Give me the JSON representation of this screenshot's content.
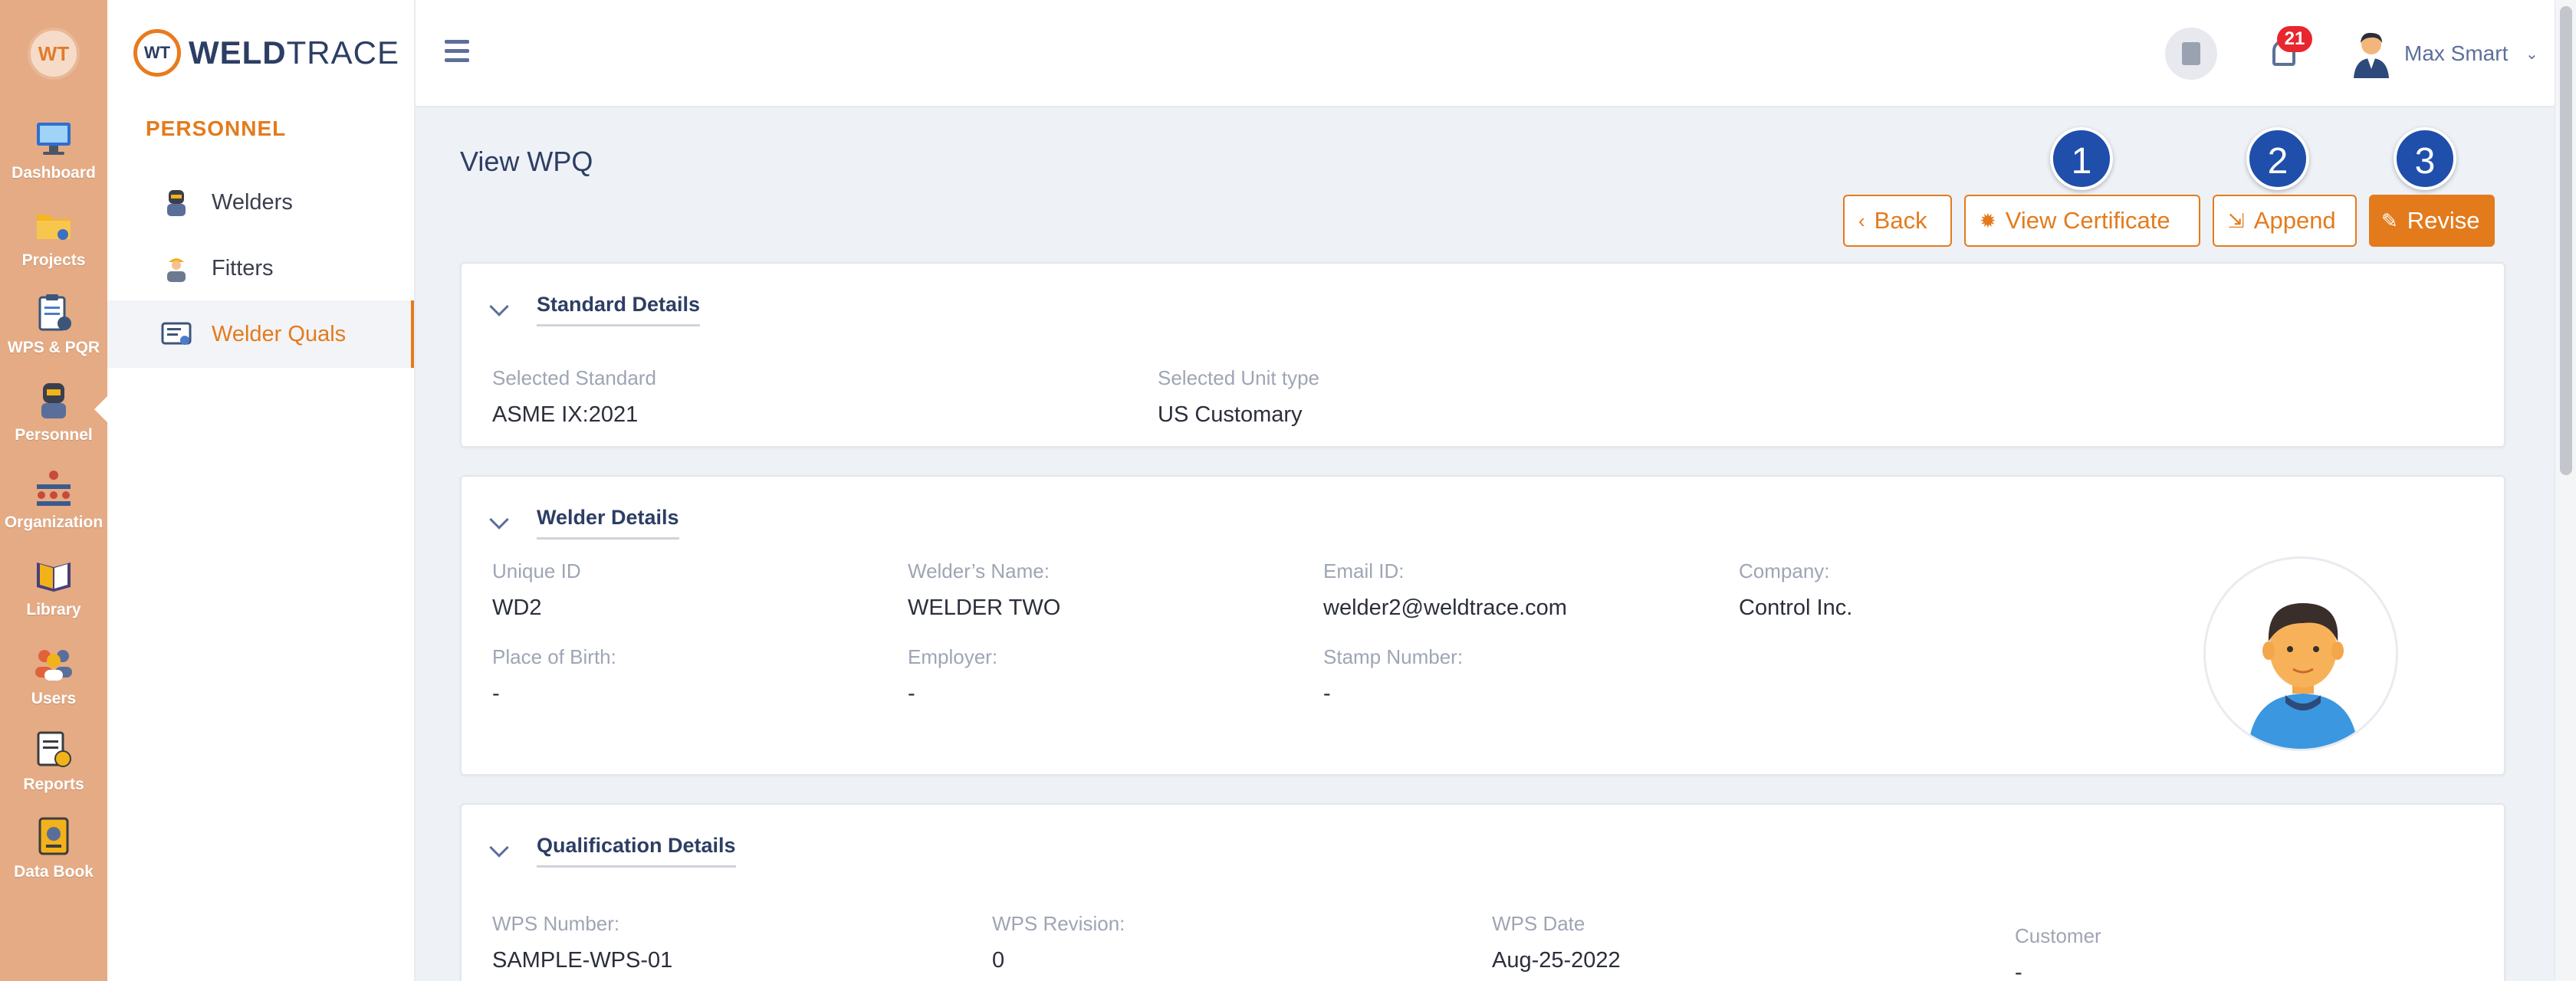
{
  "app": {
    "logo_text": "WT",
    "brand_bold": "WELD",
    "brand_light": "TRACE"
  },
  "rail": {
    "items": [
      {
        "label": "Dashboard",
        "icon": "monitor-icon",
        "color": "#3b76d1"
      },
      {
        "label": "Projects",
        "icon": "folder-icon",
        "color": "#f2b21a"
      },
      {
        "label": "WPS & PQR",
        "icon": "clipboard-icon",
        "color": "#4a7cc9"
      },
      {
        "label": "Personnel",
        "icon": "welder-icon",
        "color": "#324a6e"
      },
      {
        "label": "Organization",
        "icon": "organization-icon",
        "color": "#c94a3a"
      },
      {
        "label": "Library",
        "icon": "book-icon",
        "color": "#5a4f8e"
      },
      {
        "label": "Users",
        "icon": "users-icon",
        "color": "#e0623a"
      },
      {
        "label": "Reports",
        "icon": "report-icon",
        "color": "#3d3d3d"
      },
      {
        "label": "Data Book",
        "icon": "databook-icon",
        "color": "#f2b21a"
      }
    ]
  },
  "submenu": {
    "section": "PERSONNEL",
    "items": [
      {
        "label": "Welders",
        "icon": "welder-icon"
      },
      {
        "label": "Fitters",
        "icon": "fitter-icon"
      },
      {
        "label": "Welder Quals",
        "icon": "certificate-icon"
      }
    ]
  },
  "topbar": {
    "notification_count": "21",
    "user_name": "Max Smart"
  },
  "page": {
    "title": "View WPQ",
    "buttons": {
      "back": "Back",
      "view_certificate": "View Certificate",
      "append": "Append",
      "revise": "Revise"
    },
    "markers": [
      "1",
      "2",
      "3"
    ]
  },
  "standard": {
    "title": "Standard Details",
    "fields": [
      {
        "label": "Selected Standard",
        "value": "ASME IX:2021"
      },
      {
        "label": "Selected Unit type",
        "value": "US Customary"
      }
    ]
  },
  "welder": {
    "title": "Welder Details",
    "fields": [
      {
        "label": "Unique ID",
        "value": "WD2"
      },
      {
        "label": "Welder’s Name:",
        "value": "WELDER TWO"
      },
      {
        "label": "Email ID:",
        "value": "welder2@weldtrace.com"
      },
      {
        "label": "Company:",
        "value": "Control Inc."
      },
      {
        "label": "Place of Birth:",
        "value": "-"
      },
      {
        "label": "Employer:",
        "value": "-"
      },
      {
        "label": "Stamp Number:",
        "value": "-"
      }
    ]
  },
  "qualification": {
    "title": "Qualification Details",
    "fields": [
      {
        "label": "WPS Number:",
        "value": "SAMPLE-WPS-01"
      },
      {
        "label": "WPS Revision:",
        "value": "0"
      },
      {
        "label": "WPS Date",
        "value": "Aug-25-2022"
      },
      {
        "label": "Customer",
        "value": "-"
      }
    ]
  },
  "colors": {
    "accent": "#e37b1d",
    "navy": "#2d3e64",
    "marker": "#1f4eab",
    "rail": "#e4ab85"
  }
}
